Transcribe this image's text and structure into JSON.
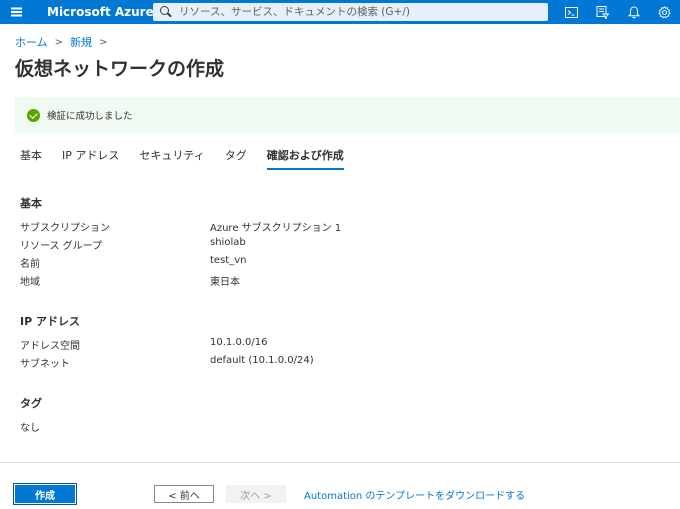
{
  "header": {
    "brand": "Microsoft Azure",
    "search_placeholder": "リソース、サービス、ドキュメントの検索 (G+/)",
    "icons": [
      "hamburger-icon",
      "search-icon",
      "cloud-shell-icon",
      "directory-filter-icon",
      "notification-bell-icon",
      "settings-gear-icon"
    ]
  },
  "breadcrumb": {
    "items": [
      "ホーム",
      "新規"
    ],
    "separator": ">"
  },
  "page_title": "仮想ネットワークの作成",
  "banner": {
    "text": "検証に成功しました",
    "color": "#57a300"
  },
  "tabs": [
    {
      "label": "基本"
    },
    {
      "label": "IP アドレス"
    },
    {
      "label": "セキュリティ"
    },
    {
      "label": "タグ"
    },
    {
      "label": "確認および作成",
      "active": true
    }
  ],
  "sections": {
    "basics": {
      "title": "基本",
      "rows": [
        {
          "k": "サブスクリプション",
          "v": "Azure サブスクリプション 1"
        },
        {
          "k": "リソース グループ",
          "v": "shiolab"
        },
        {
          "k": "名前",
          "v": "test_vn"
        },
        {
          "k": "地域",
          "v": "東日本"
        }
      ]
    },
    "ip": {
      "title": "IP アドレス",
      "rows": [
        {
          "k": "アドレス空間",
          "v": "10.1.0.0/16"
        },
        {
          "k": "サブネット",
          "v": "default (10.1.0.0/24)"
        }
      ]
    },
    "tags": {
      "title": "タグ",
      "value": "なし"
    }
  },
  "footer": {
    "create": "作成",
    "prev": "< 前へ",
    "next": "次へ >",
    "automation_link": "Automation のテンプレートをダウンロードする"
  },
  "colors": {
    "accent": "#0078d4",
    "success": "#57a300",
    "banner_bg": "#f1faf1"
  }
}
